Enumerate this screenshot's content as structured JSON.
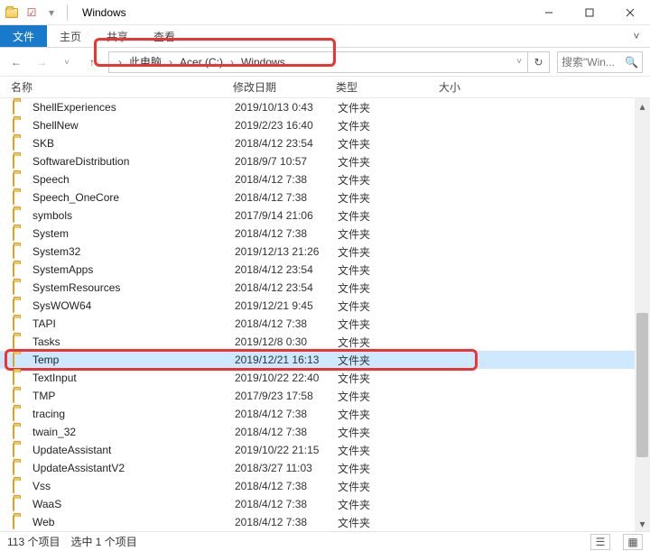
{
  "window": {
    "title": "Windows"
  },
  "ribbon": {
    "file": "文件",
    "tabs": [
      "主页",
      "共享",
      "查看"
    ]
  },
  "breadcrumb": {
    "seg0": "此电脑",
    "seg1": "Acer (C:)",
    "seg2": "Windows"
  },
  "search": {
    "placeholder": "搜索\"Win..."
  },
  "columns": {
    "name": "名称",
    "date": "修改日期",
    "type": "类型",
    "size": "大小"
  },
  "rows": [
    {
      "name": "ShellExperiences",
      "date": "2019/10/13 0:43",
      "type": "文件夹"
    },
    {
      "name": "ShellNew",
      "date": "2019/2/23 16:40",
      "type": "文件夹"
    },
    {
      "name": "SKB",
      "date": "2018/4/12 23:54",
      "type": "文件夹"
    },
    {
      "name": "SoftwareDistribution",
      "date": "2018/9/7 10:57",
      "type": "文件夹"
    },
    {
      "name": "Speech",
      "date": "2018/4/12 7:38",
      "type": "文件夹"
    },
    {
      "name": "Speech_OneCore",
      "date": "2018/4/12 7:38",
      "type": "文件夹"
    },
    {
      "name": "symbols",
      "date": "2017/9/14 21:06",
      "type": "文件夹"
    },
    {
      "name": "System",
      "date": "2018/4/12 7:38",
      "type": "文件夹"
    },
    {
      "name": "System32",
      "date": "2019/12/13 21:26",
      "type": "文件夹"
    },
    {
      "name": "SystemApps",
      "date": "2018/4/12 23:54",
      "type": "文件夹"
    },
    {
      "name": "SystemResources",
      "date": "2018/4/12 23:54",
      "type": "文件夹"
    },
    {
      "name": "SysWOW64",
      "date": "2019/12/21 9:45",
      "type": "文件夹"
    },
    {
      "name": "TAPI",
      "date": "2018/4/12 7:38",
      "type": "文件夹"
    },
    {
      "name": "Tasks",
      "date": "2019/12/8 0:30",
      "type": "文件夹"
    },
    {
      "name": "Temp",
      "date": "2019/12/21 16:13",
      "type": "文件夹",
      "selected": true
    },
    {
      "name": "TextInput",
      "date": "2019/10/22 22:40",
      "type": "文件夹"
    },
    {
      "name": "TMP",
      "date": "2017/9/23 17:58",
      "type": "文件夹"
    },
    {
      "name": "tracing",
      "date": "2018/4/12 7:38",
      "type": "文件夹"
    },
    {
      "name": "twain_32",
      "date": "2018/4/12 7:38",
      "type": "文件夹"
    },
    {
      "name": "UpdateAssistant",
      "date": "2019/10/22 21:15",
      "type": "文件夹"
    },
    {
      "name": "UpdateAssistantV2",
      "date": "2018/3/27 11:03",
      "type": "文件夹"
    },
    {
      "name": "Vss",
      "date": "2018/4/12 7:38",
      "type": "文件夹"
    },
    {
      "name": "WaaS",
      "date": "2018/4/12 7:38",
      "type": "文件夹"
    },
    {
      "name": "Web",
      "date": "2018/4/12 7:38",
      "type": "文件夹"
    }
  ],
  "status": {
    "count": "113 个项目",
    "selected": "选中 1 个项目"
  }
}
